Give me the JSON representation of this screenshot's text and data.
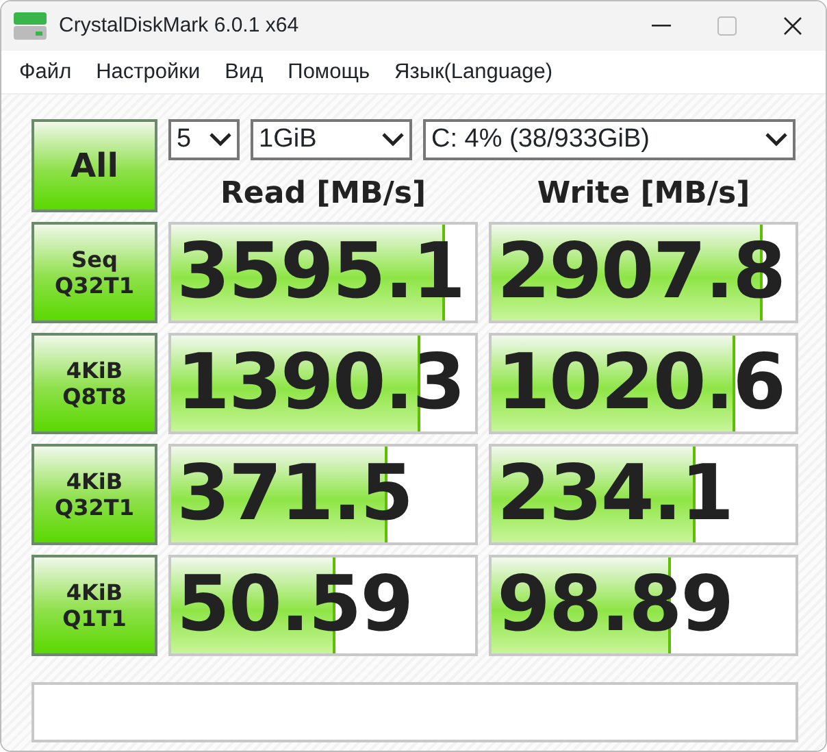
{
  "window": {
    "title": "CrystalDiskMark 6.0.1 x64"
  },
  "menu": [
    "Файл",
    "Настройки",
    "Вид",
    "Помощь",
    "Язык(Language)"
  ],
  "all_button": "All",
  "selects": [
    {
      "value": "5"
    },
    {
      "value": "1GiB"
    },
    {
      "value": "C: 4% (38/933GiB)"
    }
  ],
  "columns": [
    "Read [MB/s]",
    "Write [MB/s]"
  ],
  "tests": [
    {
      "label": [
        "Seq",
        "Q32T1"
      ],
      "read": {
        "value": "3595.1",
        "level": 0.9
      },
      "write": {
        "value": "2907.8",
        "level": 0.89
      }
    },
    {
      "label": [
        "4KiB",
        "Q8T8"
      ],
      "read": {
        "value": "1390.3",
        "level": 0.82
      },
      "write": {
        "value": "1020.6",
        "level": 0.8
      }
    },
    {
      "label": [
        "4KiB",
        "Q32T1"
      ],
      "read": {
        "value": "371.5",
        "level": 0.71
      },
      "write": {
        "value": "234.1",
        "level": 0.67
      }
    },
    {
      "label": [
        "4KiB",
        "Q1T1"
      ],
      "read": {
        "value": "50.59",
        "level": 0.54
      },
      "write": {
        "value": "98.89",
        "level": 0.59
      }
    }
  ]
}
